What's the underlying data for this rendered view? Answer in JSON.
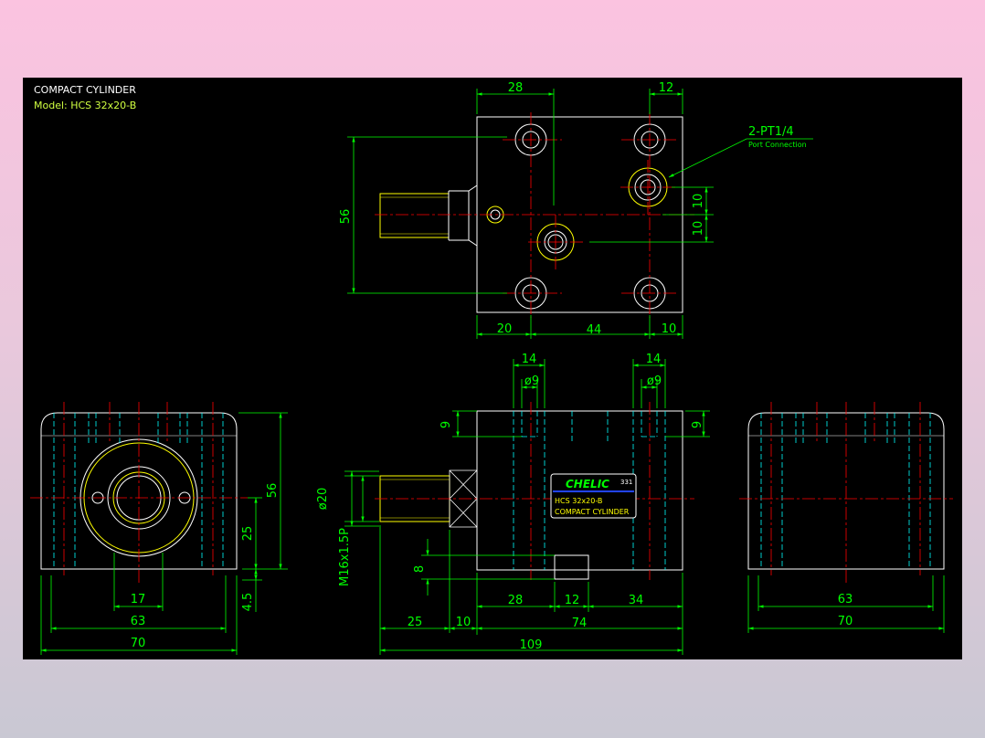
{
  "header": {
    "title": "COMPACT CYLINDER",
    "model": "Model:  HCS  32x20-B"
  },
  "callout": {
    "port_label": "2-PT1/4",
    "port_note": "Port Connection"
  },
  "nameplate": {
    "brand": "CHELIC",
    "code": "331",
    "model": "HCS  32x20-B",
    "desc": "COMPACT CYLINDER"
  },
  "dims": {
    "top_28": "28",
    "top_12": "12",
    "top_56": "56",
    "top_10a": "10",
    "top_10b": "10",
    "top_20": "20",
    "top_44": "44",
    "top_10c": "10",
    "sv_14a": "14",
    "sv_14b": "14",
    "sv_d9a": "ø9",
    "sv_d9b": "ø9",
    "sv_9a": "9",
    "sv_9b": "9",
    "sv_d20": "ø20",
    "sv_thread": "M16x1.5P",
    "sv_8": "8",
    "sv_28": "28",
    "sv_12": "12",
    "sv_34": "34",
    "sv_25": "25",
    "sv_10": "10",
    "sv_74": "74",
    "sv_109": "109",
    "lv_56": "56",
    "lv_25": "25",
    "lv_45": "4.5",
    "lv_17": "17",
    "lv_63": "63",
    "lv_70": "70",
    "rv_63": "63",
    "rv_70": "70"
  },
  "colors": {
    "dimension": "#00ff00",
    "outline": "#ffffff",
    "centerline": "#ff0000",
    "hidden": "#00ffff",
    "thread": "#ffff00"
  }
}
